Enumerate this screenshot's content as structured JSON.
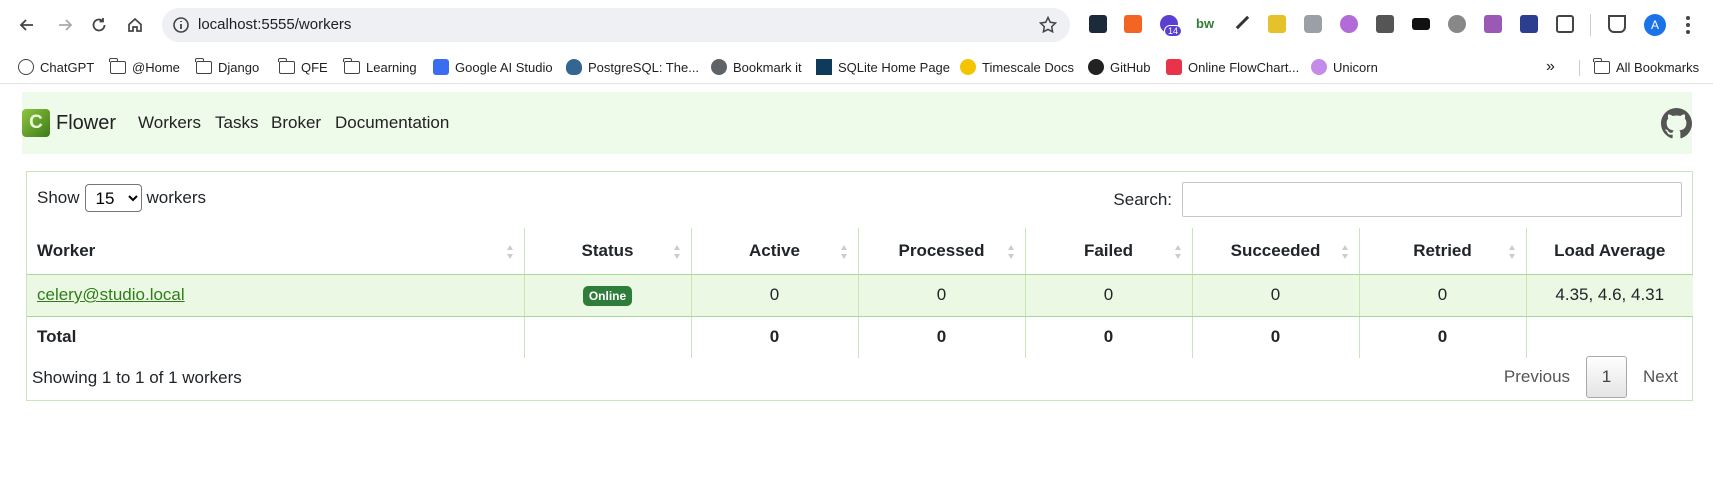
{
  "browser": {
    "url": "localhost:5555/workers",
    "extension_badge": "14",
    "profile_initial": "A",
    "bookmarks": [
      {
        "label": "ChatGPT",
        "icon": "chatgpt-icon"
      },
      {
        "label": "@Home",
        "icon": "folder-icon"
      },
      {
        "label": "Django",
        "icon": "folder-icon"
      },
      {
        "label": "QFE",
        "icon": "folder-icon"
      },
      {
        "label": "Learning",
        "icon": "folder-icon"
      },
      {
        "label": "Google AI Studio",
        "icon": "ai-studio-icon"
      },
      {
        "label": "PostgreSQL: The...",
        "icon": "postgresql-icon"
      },
      {
        "label": "Bookmark it",
        "icon": "globe-icon"
      },
      {
        "label": "SQLite Home Page",
        "icon": "sqlite-icon"
      },
      {
        "label": "Timescale Docs",
        "icon": "timescale-icon"
      },
      {
        "label": "GitHub",
        "icon": "github-icon"
      },
      {
        "label": "Online FlowChart...",
        "icon": "flowchart-icon"
      },
      {
        "label": "Unicorn",
        "icon": "unicorn-icon"
      }
    ],
    "all_bookmarks_label": "All Bookmarks"
  },
  "app": {
    "brand_letter": "C",
    "brand_name": "Flower",
    "nav": [
      "Workers",
      "Tasks",
      "Broker",
      "Documentation"
    ]
  },
  "controls": {
    "show_label": "Show",
    "page_size": "15",
    "page_size_options": [
      "15"
    ],
    "workers_label": "workers",
    "search_label": "Search:",
    "search_value": ""
  },
  "table": {
    "columns": [
      "Worker",
      "Status",
      "Active",
      "Processed",
      "Failed",
      "Succeeded",
      "Retried",
      "Load Average"
    ],
    "rows": [
      {
        "worker": "celery@studio.local",
        "status": "Online",
        "active": "0",
        "processed": "0",
        "failed": "0",
        "succeeded": "0",
        "retried": "0",
        "load_average": "4.35, 4.6, 4.31"
      }
    ],
    "total": {
      "label": "Total",
      "active": "0",
      "processed": "0",
      "failed": "0",
      "succeeded": "0",
      "retried": "0"
    }
  },
  "footer": {
    "info": "Showing 1 to 1 of 1 workers",
    "previous": "Previous",
    "current_page": "1",
    "next": "Next"
  },
  "colors": {
    "navbar_bg": "#effbea",
    "row_bg": "#ebf9e4",
    "badge_bg": "#2f7d3a",
    "link": "#2f7d1b"
  }
}
